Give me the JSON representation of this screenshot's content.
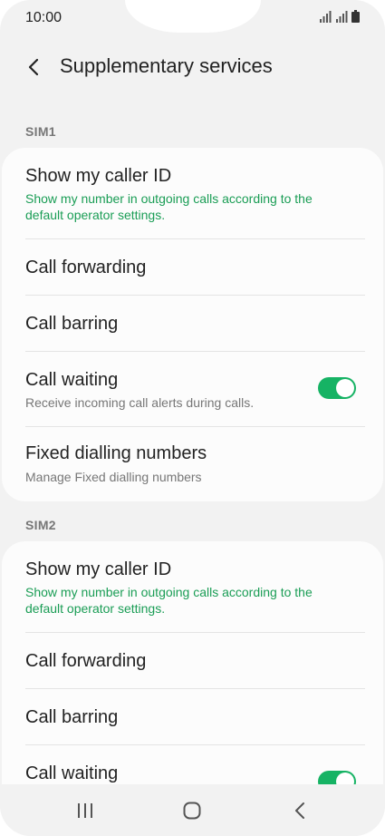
{
  "status": {
    "time": "10:00"
  },
  "appbar": {
    "title": "Supplementary services"
  },
  "sim1": {
    "label": "SIM1",
    "items": [
      {
        "title": "Show my caller ID",
        "subtitle": "Show my number in outgoing calls according to the default operator settings."
      },
      {
        "title": "Call forwarding"
      },
      {
        "title": "Call barring"
      },
      {
        "title": "Call waiting",
        "subtitle": "Receive incoming call alerts during calls.",
        "toggle": true
      },
      {
        "title": "Fixed dialling numbers",
        "subtitle": "Manage Fixed dialling numbers"
      }
    ]
  },
  "sim2": {
    "label": "SIM2",
    "items": [
      {
        "title": "Show my caller ID",
        "subtitle": "Show my number in outgoing calls according to the default operator settings."
      },
      {
        "title": "Call forwarding"
      },
      {
        "title": "Call barring"
      },
      {
        "title": "Call waiting",
        "toggle": true
      }
    ]
  },
  "colors": {
    "accent": "#16b364",
    "subtitle_green": "#1a9d55",
    "background": "#f2f2f2",
    "card": "#fcfcfc"
  },
  "icons": {
    "back": "chevron-left-icon",
    "nav_recents": "recents-icon",
    "nav_home": "home-icon",
    "nav_back": "back-icon"
  }
}
